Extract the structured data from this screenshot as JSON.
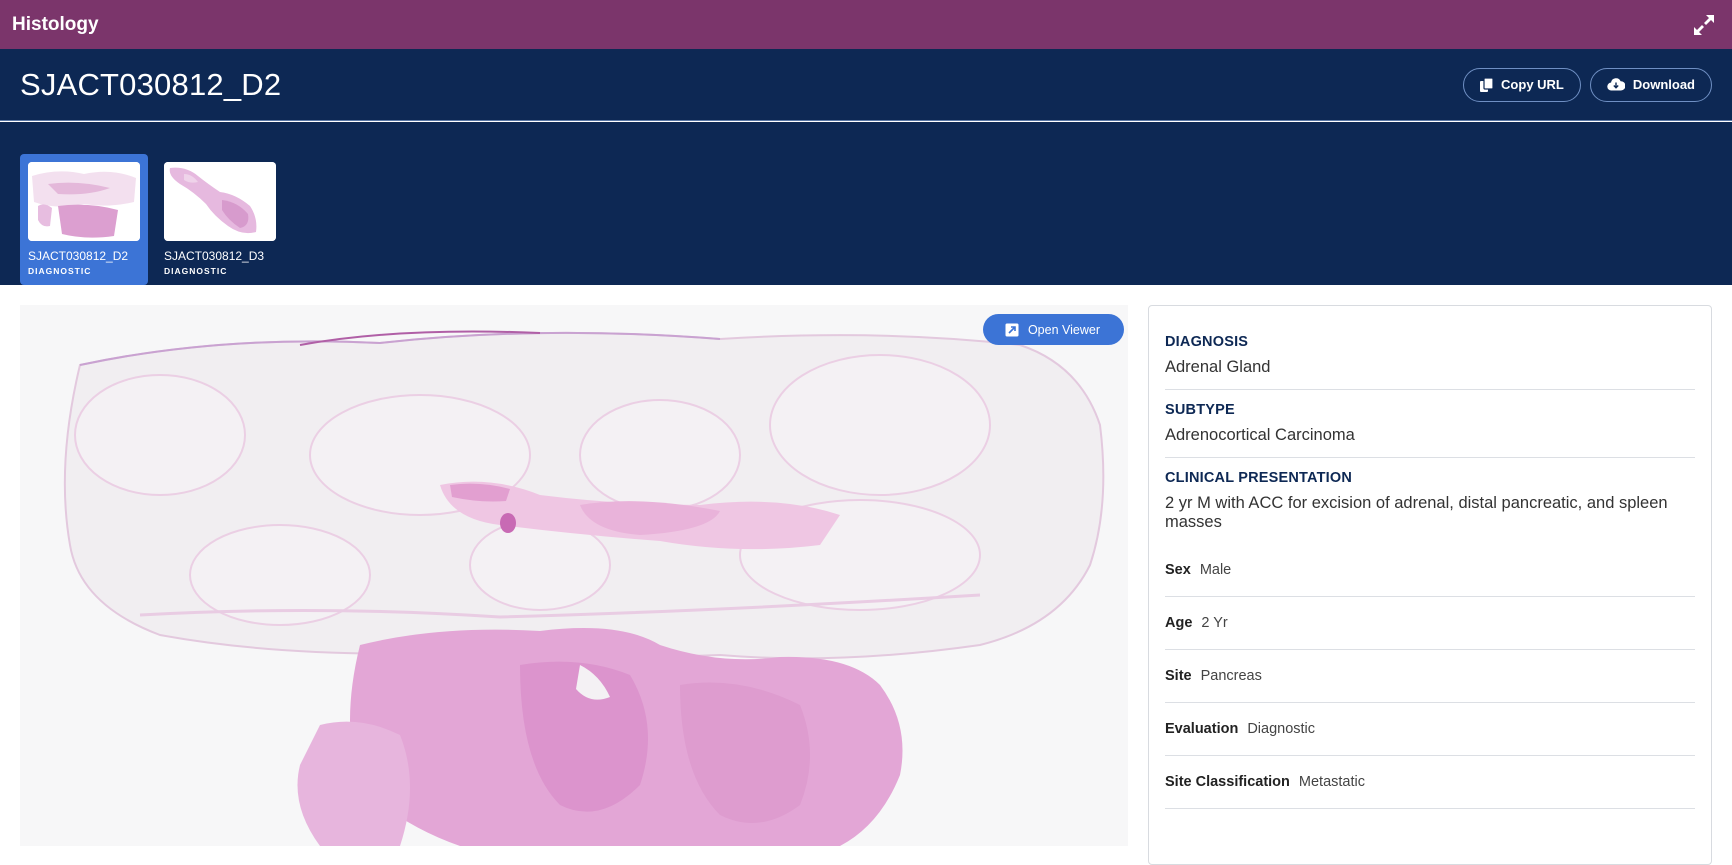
{
  "app": {
    "title": "Histology"
  },
  "header": {
    "title": "SJACT030812_D2",
    "copy_url_label": "Copy URL",
    "download_label": "Download"
  },
  "thumbnails": [
    {
      "name": "SJACT030812_D2",
      "type": "DIAGNOSTIC",
      "selected": true
    },
    {
      "name": "SJACT030812_D3",
      "type": "DIAGNOSTIC",
      "selected": false
    }
  ],
  "viewer": {
    "open_viewer_label": "Open Viewer"
  },
  "details": {
    "diagnosis": {
      "label": "DIAGNOSIS",
      "value": "Adrenal Gland"
    },
    "subtype": {
      "label": "SUBTYPE",
      "value": "Adrenocortical Carcinoma"
    },
    "clinical": {
      "label": "CLINICAL PRESENTATION",
      "value": "2 yr M with ACC for excision of adrenal, distal pancreatic, and spleen masses"
    },
    "fields": [
      {
        "key": "Sex",
        "value": "Male"
      },
      {
        "key": "Age",
        "value": "2 Yr"
      },
      {
        "key": "Site",
        "value": "Pancreas"
      },
      {
        "key": "Evaluation",
        "value": "Diagnostic"
      },
      {
        "key": "Site Classification",
        "value": "Metastatic"
      }
    ]
  },
  "colors": {
    "topbar": "#7b356b",
    "header": "#0d2854",
    "accent": "#3c74d6"
  }
}
